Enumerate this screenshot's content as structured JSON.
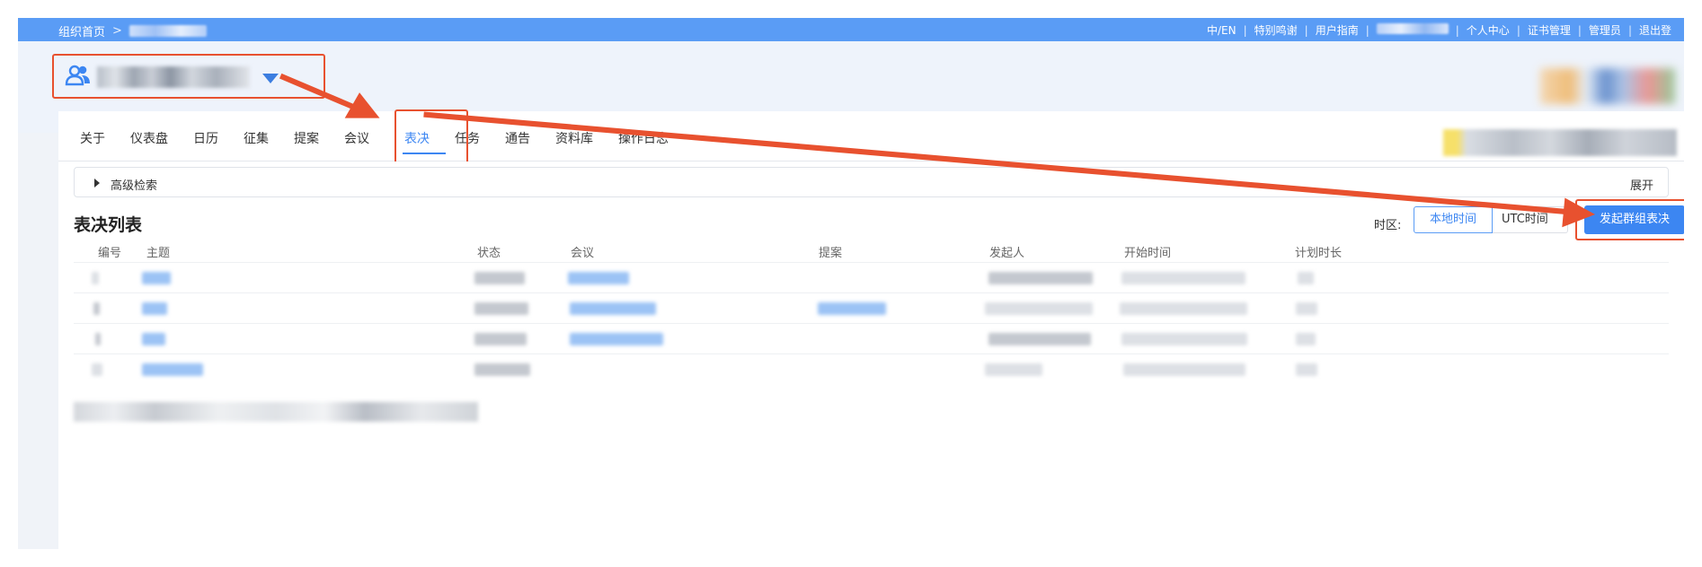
{
  "topbar": {
    "home": "组织首页",
    "separator": ">",
    "links": [
      "中/EN",
      "特别鸣谢",
      "用户指南",
      "个人中心",
      "证书管理",
      "管理员",
      "退出登"
    ],
    "bg_color": "#5a9cf5"
  },
  "tabs": [
    {
      "label": "关于"
    },
    {
      "label": "仪表盘"
    },
    {
      "label": "日历"
    },
    {
      "label": "征集"
    },
    {
      "label": "提案"
    },
    {
      "label": "会议"
    },
    {
      "label": "表决",
      "active": true
    },
    {
      "label": "任务"
    },
    {
      "label": "通告"
    },
    {
      "label": "资料库"
    },
    {
      "label": "操作日志"
    }
  ],
  "search": {
    "label": "高级检索",
    "expand": "展开"
  },
  "list": {
    "title": "表决列表",
    "timezone_label": "时区:",
    "tz_local": "本地时间",
    "tz_utc": "UTC时间",
    "start_button": "发起群组表决",
    "columns": [
      "编号",
      "主题",
      "状态",
      "会议",
      "提案",
      "发起人",
      "开始时间",
      "计划时长"
    ]
  },
  "colors": {
    "accent": "#3c86f2",
    "annotation": "#e8512f",
    "icon_users": "#3c86f2"
  },
  "icons": {
    "org": "users-icon",
    "caret": "caret-down-icon",
    "expand": "triangle-right-icon"
  }
}
